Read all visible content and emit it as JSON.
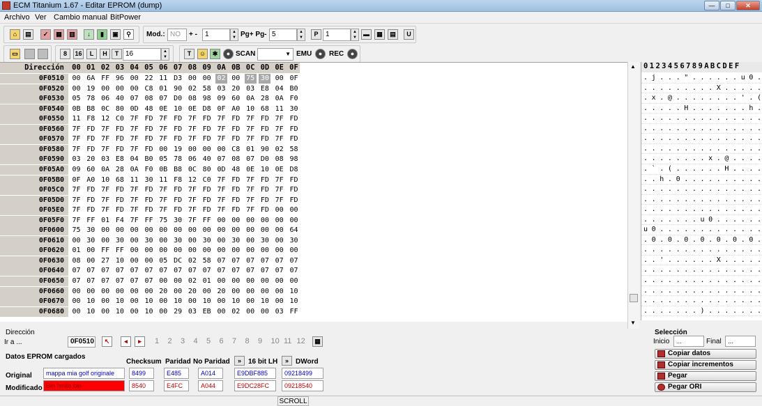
{
  "window": {
    "title": "ECM Titanium 1.67 - Editar EPROM (dump)"
  },
  "menu": [
    "Archivo",
    "Ver",
    "Cambio manual",
    "BitPower"
  ],
  "toolbar1": {
    "mod_label": "Mod.:",
    "mod_value": "NO",
    "plusminus_label": "+ -",
    "step_value": "1",
    "pg_label": "Pg+ Pg-",
    "pg_value": "5",
    "p_value": "1"
  },
  "toolbar2": {
    "width_value": "16",
    "scan_label": "SCAN",
    "emu_label": "EMU",
    "rec_label": "REC"
  },
  "hex": {
    "header_addr": "Dirección",
    "columns": [
      "00",
      "01",
      "02",
      "03",
      "04",
      "05",
      "06",
      "07",
      "08",
      "09",
      "0A",
      "0B",
      "0C",
      "0D",
      "0E",
      "0F"
    ],
    "rows": [
      {
        "addr": "0F0510",
        "bytes": [
          "00",
          "6A",
          "FF",
          "96",
          "00",
          "22",
          "11",
          "D3",
          "00",
          "00",
          "02",
          "00",
          "75",
          "30",
          "00",
          "0F"
        ]
      },
      {
        "addr": "0F0520",
        "bytes": [
          "00",
          "19",
          "00",
          "00",
          "00",
          "C8",
          "01",
          "90",
          "02",
          "58",
          "03",
          "20",
          "03",
          "E8",
          "04",
          "B0"
        ]
      },
      {
        "addr": "0F0530",
        "bytes": [
          "05",
          "78",
          "06",
          "40",
          "07",
          "08",
          "07",
          "D0",
          "08",
          "98",
          "09",
          "60",
          "0A",
          "28",
          "0A",
          "F0"
        ]
      },
      {
        "addr": "0F0540",
        "bytes": [
          "0B",
          "B8",
          "0C",
          "80",
          "0D",
          "48",
          "0E",
          "10",
          "0E",
          "D8",
          "0F",
          "A0",
          "10",
          "68",
          "11",
          "30"
        ]
      },
      {
        "addr": "0F0550",
        "bytes": [
          "11",
          "F8",
          "12",
          "C0",
          "7F",
          "FD",
          "7F",
          "FD",
          "7F",
          "FD",
          "7F",
          "FD",
          "7F",
          "FD",
          "7F",
          "FD"
        ]
      },
      {
        "addr": "0F0560",
        "bytes": [
          "7F",
          "FD",
          "7F",
          "FD",
          "7F",
          "FD",
          "7F",
          "FD",
          "7F",
          "FD",
          "7F",
          "FD",
          "7F",
          "FD",
          "7F",
          "FD"
        ]
      },
      {
        "addr": "0F0570",
        "bytes": [
          "7F",
          "FD",
          "7F",
          "FD",
          "7F",
          "FD",
          "7F",
          "FD",
          "7F",
          "FD",
          "7F",
          "FD",
          "7F",
          "FD",
          "7F",
          "FD"
        ]
      },
      {
        "addr": "0F0580",
        "bytes": [
          "7F",
          "FD",
          "7F",
          "FD",
          "7F",
          "FD",
          "00",
          "19",
          "00",
          "00",
          "00",
          "C8",
          "01",
          "90",
          "02",
          "58"
        ]
      },
      {
        "addr": "0F0590",
        "bytes": [
          "03",
          "20",
          "03",
          "E8",
          "04",
          "B0",
          "05",
          "78",
          "06",
          "40",
          "07",
          "08",
          "07",
          "D0",
          "08",
          "98"
        ]
      },
      {
        "addr": "0F05A0",
        "bytes": [
          "09",
          "60",
          "0A",
          "28",
          "0A",
          "F0",
          "0B",
          "B8",
          "0C",
          "80",
          "0D",
          "48",
          "0E",
          "10",
          "0E",
          "D8"
        ]
      },
      {
        "addr": "0F05B0",
        "bytes": [
          "0F",
          "A0",
          "10",
          "68",
          "11",
          "30",
          "11",
          "F8",
          "12",
          "C0",
          "7F",
          "FD",
          "7F",
          "FD",
          "7F",
          "FD"
        ]
      },
      {
        "addr": "0F05C0",
        "bytes": [
          "7F",
          "FD",
          "7F",
          "FD",
          "7F",
          "FD",
          "7F",
          "FD",
          "7F",
          "FD",
          "7F",
          "FD",
          "7F",
          "FD",
          "7F",
          "FD"
        ]
      },
      {
        "addr": "0F05D0",
        "bytes": [
          "7F",
          "FD",
          "7F",
          "FD",
          "7F",
          "FD",
          "7F",
          "FD",
          "7F",
          "FD",
          "7F",
          "FD",
          "7F",
          "FD",
          "7F",
          "FD"
        ]
      },
      {
        "addr": "0F05E0",
        "bytes": [
          "7F",
          "FD",
          "7F",
          "FD",
          "7F",
          "FD",
          "7F",
          "FD",
          "7F",
          "FD",
          "7F",
          "FD",
          "7F",
          "FD",
          "00",
          "00"
        ]
      },
      {
        "addr": "0F05F0",
        "bytes": [
          "7F",
          "FF",
          "01",
          "F4",
          "7F",
          "FF",
          "75",
          "30",
          "7F",
          "FF",
          "00",
          "00",
          "00",
          "00",
          "00",
          "00"
        ]
      },
      {
        "addr": "0F0600",
        "bytes": [
          "75",
          "30",
          "00",
          "00",
          "00",
          "00",
          "00",
          "00",
          "00",
          "00",
          "00",
          "00",
          "00",
          "00",
          "00",
          "64"
        ]
      },
      {
        "addr": "0F0610",
        "bytes": [
          "00",
          "30",
          "00",
          "30",
          "00",
          "30",
          "00",
          "30",
          "00",
          "30",
          "00",
          "30",
          "00",
          "30",
          "00",
          "30"
        ]
      },
      {
        "addr": "0F0620",
        "bytes": [
          "01",
          "00",
          "FF",
          "FF",
          "00",
          "00",
          "00",
          "00",
          "00",
          "00",
          "00",
          "00",
          "00",
          "00",
          "00",
          "00"
        ]
      },
      {
        "addr": "0F0630",
        "bytes": [
          "08",
          "00",
          "27",
          "10",
          "00",
          "00",
          "05",
          "DC",
          "02",
          "58",
          "07",
          "07",
          "07",
          "07",
          "07",
          "07"
        ]
      },
      {
        "addr": "0F0640",
        "bytes": [
          "07",
          "07",
          "07",
          "07",
          "07",
          "07",
          "07",
          "07",
          "07",
          "07",
          "07",
          "07",
          "07",
          "07",
          "07",
          "07"
        ]
      },
      {
        "addr": "0F0650",
        "bytes": [
          "07",
          "07",
          "07",
          "07",
          "07",
          "07",
          "00",
          "00",
          "02",
          "01",
          "00",
          "00",
          "00",
          "00",
          "00",
          "00"
        ]
      },
      {
        "addr": "0F0660",
        "bytes": [
          "00",
          "00",
          "00",
          "00",
          "00",
          "00",
          "20",
          "00",
          "20",
          "00",
          "20",
          "00",
          "00",
          "00",
          "00",
          "10"
        ]
      },
      {
        "addr": "0F0670",
        "bytes": [
          "00",
          "10",
          "00",
          "10",
          "00",
          "10",
          "00",
          "10",
          "00",
          "10",
          "00",
          "10",
          "00",
          "10",
          "00",
          "10"
        ]
      },
      {
        "addr": "0F0680",
        "bytes": [
          "00",
          "10",
          "00",
          "10",
          "00",
          "10",
          "00",
          "29",
          "03",
          "EB",
          "00",
          "02",
          "00",
          "00",
          "03",
          "FF"
        ]
      }
    ]
  },
  "ascii": {
    "header": "0123456789ABCDEF",
    "rows": [
      ". j . . . \" . . . . . . u 0 . .",
      ". . . . . . . . . X . . . . . .",
      ". x . @ . . . . . . . . ' . ( .",
      ". . . . . H . . . . . . . h . 0",
      ". . . . . . . . . . . . . . . .",
      ". . . . . . . . . . . . . . . .",
      ". . . . . . . . . . . . . . . .",
      ". . . . . . . . . . . . . . . X",
      ". . . . . . . . x . @ . . . . .",
      ". ` . ( . . . . . . H . . . . .",
      ". . h . 0 . . . . . . . . . . .",
      ". . . . . . . . . . . . . . . .",
      ". . . . . . . . . . . . . . . .",
      ". . . . . . . . . . . . . . . .",
      ". . . . . . . u 0 . . . . . . .",
      "u 0 . . . . . . . . . . . . . d",
      ". 0 . 0 . 0 . 0 . 0 . 0 . 0 . 0",
      ". . . . . . . . . . . . . . . .",
      ". . ' . . . . . . X . . . . . .",
      ". . . . . . . . . . . . . . . .",
      ". . . . . . . . . . . . . . . .",
      ". . . . . . . . . . . . . . . .",
      ". . . . . . . . . . . . . . . .",
      ". . . . . . . ) . . . . . . . ."
    ]
  },
  "direccion": {
    "title": "Dirección",
    "goto_label": "Ir a ...",
    "goto_value": "0F0510",
    "nums": [
      "1",
      "2",
      "3",
      "4",
      "5",
      "6",
      "7",
      "8",
      "9",
      "10",
      "11",
      "12"
    ]
  },
  "datos": {
    "title": "Datos EPROM cargados",
    "headers": [
      "Checksum",
      "Paridad",
      "No Paridad",
      "16 bit LH",
      "DWord"
    ],
    "original_label": "Original",
    "modificado_label": "Modificado",
    "original": {
      "file": "mappa mia golf originale",
      "checksum": "8499",
      "paridad": "E485",
      "no_paridad": "A014",
      "bit16": "E9DBF885",
      "dword": "09218499"
    },
    "modificado": {
      "file": "Bin limite.bin",
      "checksum": "8540",
      "paridad": "E4FC",
      "no_paridad": "A044",
      "bit16": "E9DC28FC",
      "dword": "09218540"
    }
  },
  "seleccion": {
    "title": "Selección",
    "inicio_label": "Inicio",
    "inicio_value": "...",
    "final_label": "Final",
    "final_value": "...",
    "buttons": [
      "Copiar datos",
      "Copiar incrementos",
      "Pegar",
      "Pegar ORI"
    ]
  },
  "status": {
    "scroll": "SCROLL"
  }
}
